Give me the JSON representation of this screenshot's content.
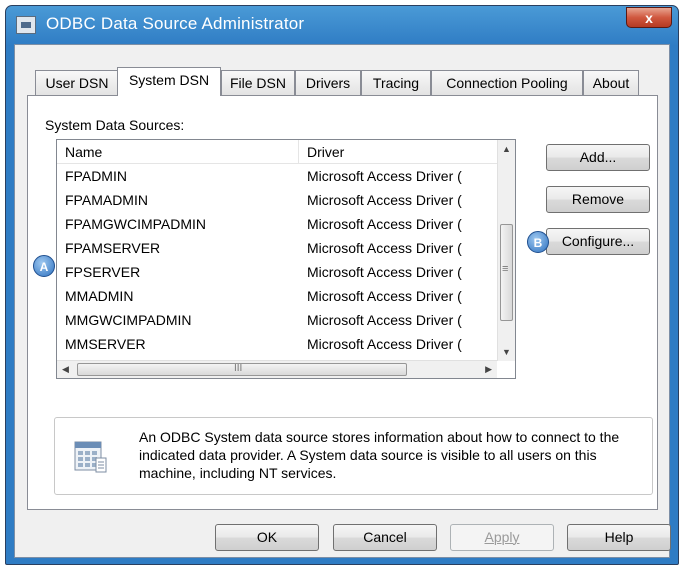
{
  "window": {
    "title": "ODBC Data Source Administrator",
    "close_label": "x"
  },
  "tabs": [
    {
      "label": "User DSN"
    },
    {
      "label": "System DSN"
    },
    {
      "label": "File DSN"
    },
    {
      "label": "Drivers"
    },
    {
      "label": "Tracing"
    },
    {
      "label": "Connection Pooling"
    },
    {
      "label": "About"
    }
  ],
  "active_tab": "System DSN",
  "section_label": "System Data Sources:",
  "list": {
    "columns": [
      "Name",
      "Driver"
    ],
    "rows": [
      {
        "name": "FPADMIN",
        "driver": "Microsoft Access Driver ("
      },
      {
        "name": "FPAMADMIN",
        "driver": "Microsoft Access Driver ("
      },
      {
        "name": "FPAMGWCIMPADMIN",
        "driver": "Microsoft Access Driver ("
      },
      {
        "name": "FPAMSERVER",
        "driver": "Microsoft Access Driver ("
      },
      {
        "name": "FPSERVER",
        "driver": "Microsoft Access Driver ("
      },
      {
        "name": "MMADMIN",
        "driver": "Microsoft Access Driver ("
      },
      {
        "name": "MMGWCIMPADMIN",
        "driver": "Microsoft Access Driver ("
      },
      {
        "name": "MMSERVER",
        "driver": "Microsoft Access Driver ("
      }
    ]
  },
  "buttons": {
    "add": "Add...",
    "remove": "Remove",
    "configure": "Configure...",
    "ok": "OK",
    "cancel": "Cancel",
    "apply": "Apply",
    "help": "Help"
  },
  "markers": {
    "a": "A",
    "b": "B"
  },
  "info": "An ODBC System data source stores information about how to connect to the indicated data provider.  A System data source is visible to all users on this machine, including NT services.",
  "scrollbar": {
    "grip": "≡",
    "hgrip": "III"
  }
}
